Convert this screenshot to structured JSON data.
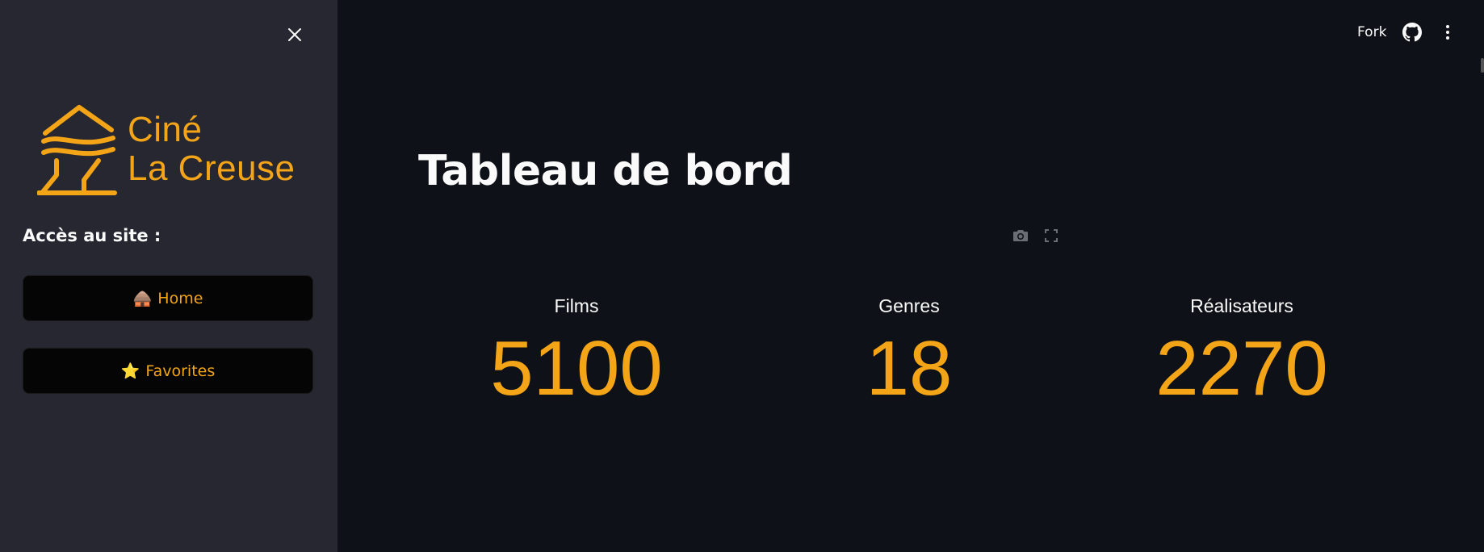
{
  "sidebar": {
    "logo_line1": "Ciné",
    "logo_line2": "La Creuse",
    "heading": "Accès au site :",
    "nav": [
      {
        "icon": "🛖",
        "label": "Home"
      },
      {
        "icon": "⭐",
        "label": "Favorites"
      }
    ]
  },
  "header": {
    "fork_label": "Fork"
  },
  "main": {
    "title": "Tableau de bord",
    "metrics": [
      {
        "label": "Films",
        "value": "5100"
      },
      {
        "label": "Genres",
        "value": "18"
      },
      {
        "label": "Réalisateurs",
        "value": "2270"
      }
    ]
  },
  "colors": {
    "accent": "#f4a517",
    "background": "#0e1117",
    "sidebar": "#262730"
  }
}
